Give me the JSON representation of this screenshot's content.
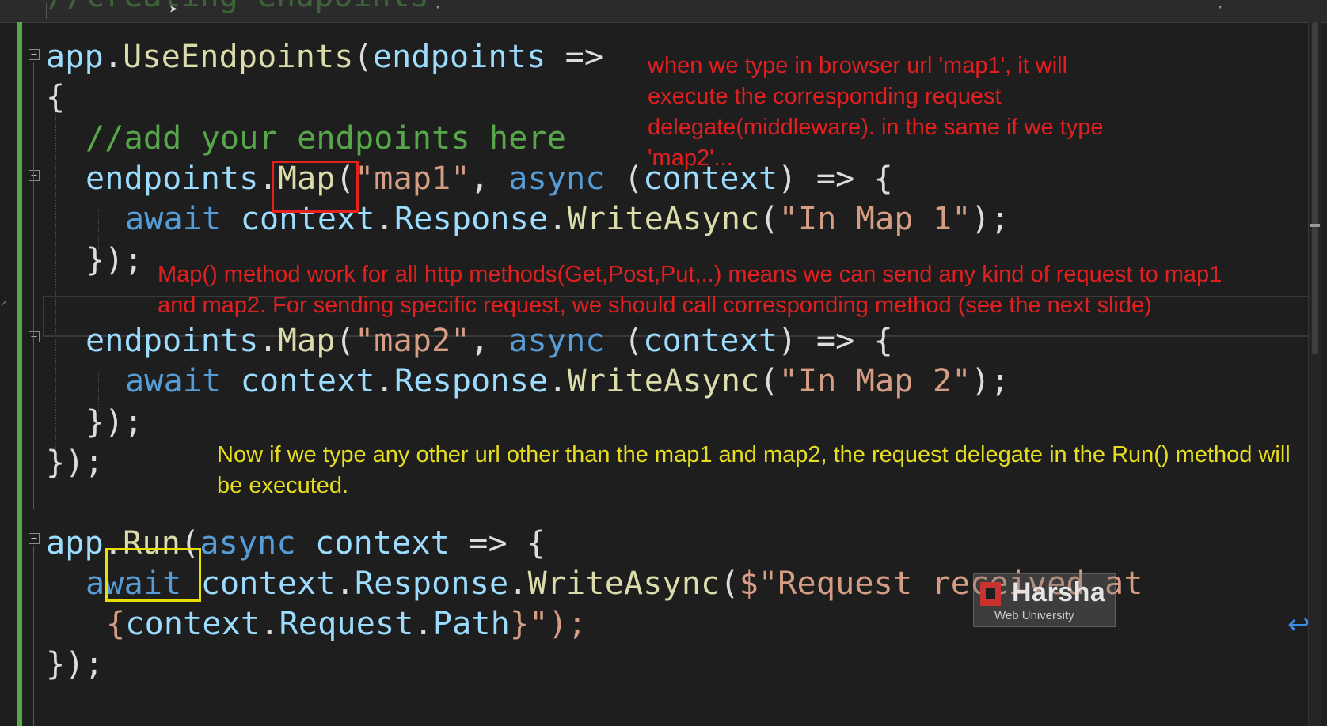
{
  "code": {
    "faint_top": "//creating endpoints",
    "line1": {
      "a": "app",
      "b": ".",
      "c": "UseEndpoints",
      "d": "(",
      "e": "endpoints",
      "f": " =>"
    },
    "line2": {
      "a": "{"
    },
    "line3": {
      "a": "//add your endpoints here"
    },
    "line4": {
      "a": "endpoints",
      "b": ".",
      "c": "Map",
      "d": "(",
      "e": "\"map1\"",
      "f": ", ",
      "g": "async",
      "h": " (",
      "i": "context",
      "j": ") => {"
    },
    "line5": {
      "a": "await",
      "b": " ",
      "c": "context",
      "d": ".",
      "e": "Response",
      "f": ".",
      "g": "WriteAsync",
      "h": "(",
      "i": "\"In Map 1\"",
      "j": ");"
    },
    "line6": {
      "a": "});"
    },
    "line7": {
      "a": "endpoints",
      "b": ".",
      "c": "Map",
      "d": "(",
      "e": "\"map2\"",
      "f": ", ",
      "g": "async",
      "h": " (",
      "i": "context",
      "j": ") => {"
    },
    "line8": {
      "a": "await",
      "b": " ",
      "c": "context",
      "d": ".",
      "e": "Response",
      "f": ".",
      "g": "WriteAsync",
      "h": "(",
      "i": "\"In Map 2\"",
      "j": ");"
    },
    "line9": {
      "a": "});"
    },
    "line10": {
      "a": "});"
    },
    "line11": {
      "a": "app",
      "b": ".",
      "c": "Run",
      "d": "(",
      "e": "async",
      "f": " ",
      "g": "context",
      "h": " => {"
    },
    "line12": {
      "a": "await",
      "b": " ",
      "c": "context",
      "d": ".",
      "e": "Response",
      "f": ".",
      "g": "WriteAsync",
      "h": "(",
      "i": "$\"Request received at"
    },
    "line13": {
      "a": "{",
      "b": "context",
      "c": ".",
      "d": "Request",
      "e": ".",
      "f": "Path",
      "g": "}\");"
    },
    "line14": {
      "a": "});"
    }
  },
  "notes": {
    "top_right": "when we type in browser url 'map1', it will\nexecute the corresponding request\ndelegate(middleware). in the same if we type\n'map2'...",
    "map_methods": "Map() method work for all http methods(Get,Post,Put,..) means we can send any kind of request to map1\nand map2. For sending specific request, we should call corresponding method (see the next slide)",
    "run_fallback": "Now if we type any other url other than the map1 and map2, the request delegate in the Run() method will\nbe executed."
  },
  "watermark": {
    "name": "Harsha",
    "tagline": "Web University"
  },
  "icons": {
    "fold": "fold-minus-icon",
    "wrap": "word-wrap-icon",
    "cursor": "mouse-cursor-icon",
    "logo": "harsha-logo-icon"
  },
  "colors": {
    "background": "#1e1e1e",
    "identifier": "#9cdcfe",
    "method": "#dcdcaa",
    "string": "#d69d85",
    "keyword": "#569cd6",
    "comment": "#57a64a",
    "annotation_red": "#e02020",
    "annotation_yellow": "#e6dc20",
    "highlight_red": "#e8201c",
    "highlight_yellow": "#e8e000"
  }
}
